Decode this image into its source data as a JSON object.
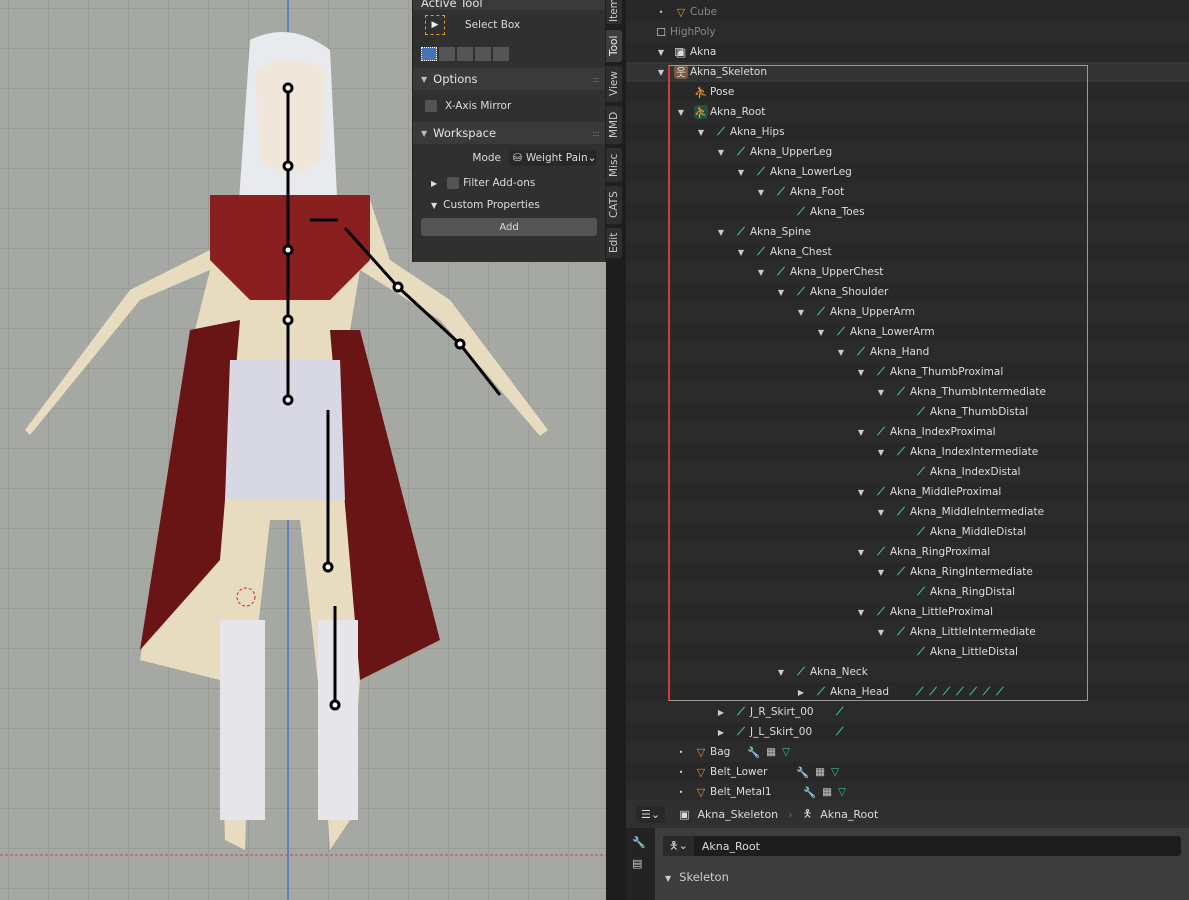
{
  "viewport": {
    "background": "#a6a8a4"
  },
  "npanel": {
    "active_tool_header": "Active Tool",
    "tool_name": "Select Box",
    "options_header": "Options",
    "x_axis_mirror": "X-Axis Mirror",
    "workspace_header": "Workspace",
    "mode_label": "Mode",
    "mode_value": "Weight Pain",
    "filter_addons": "Filter Add-ons",
    "custom_properties": "Custom Properties",
    "add_button": "Add"
  },
  "side_tabs": [
    "Item",
    "Tool",
    "View",
    "MMD",
    "Misc",
    "CATS",
    "Edit"
  ],
  "outliner": {
    "rows": [
      {
        "label": "Cube",
        "depth": 0,
        "icon": "mesh",
        "exp": "dot",
        "dim": true
      },
      {
        "label": "HighPoly",
        "depth": -1,
        "icon": "checkbox",
        "exp": "",
        "dim": true
      },
      {
        "label": "Akna",
        "depth": 0,
        "icon": "collection",
        "exp": "open",
        "check": true,
        "ind": -2
      },
      {
        "label": "Akna_Skeleton",
        "depth": 0,
        "icon": "armature",
        "exp": "open",
        "ind": -1
      },
      {
        "label": "Pose",
        "depth": 1,
        "icon": "pose",
        "exp": ""
      },
      {
        "label": "Akna_Root",
        "depth": 1,
        "icon": "armature-data",
        "exp": "open"
      },
      {
        "label": "Akna_Hips",
        "depth": 2,
        "icon": "bone",
        "exp": "open"
      },
      {
        "label": "Akna_UpperLeg",
        "depth": 3,
        "icon": "bone",
        "exp": "open"
      },
      {
        "label": "Akna_LowerLeg",
        "depth": 4,
        "icon": "bone",
        "exp": "open"
      },
      {
        "label": "Akna_Foot",
        "depth": 5,
        "icon": "bone",
        "exp": "open"
      },
      {
        "label": "Akna_Toes",
        "depth": 6,
        "icon": "bone",
        "exp": ""
      },
      {
        "label": "Akna_Spine",
        "depth": 3,
        "icon": "bone",
        "exp": "open"
      },
      {
        "label": "Akna_Chest",
        "depth": 4,
        "icon": "bone",
        "exp": "open"
      },
      {
        "label": "Akna_UpperChest",
        "depth": 5,
        "icon": "bone",
        "exp": "open"
      },
      {
        "label": "Akna_Shoulder",
        "depth": 6,
        "icon": "bone",
        "exp": "open"
      },
      {
        "label": "Akna_UpperArm",
        "depth": 7,
        "icon": "bone",
        "exp": "open"
      },
      {
        "label": "Akna_LowerArm",
        "depth": 8,
        "icon": "bone",
        "exp": "open"
      },
      {
        "label": "Akna_Hand",
        "depth": 9,
        "icon": "bone",
        "exp": "open"
      },
      {
        "label": "Akna_ThumbProximal",
        "depth": 10,
        "icon": "bone",
        "exp": "open"
      },
      {
        "label": "Akna_ThumbIntermediate",
        "depth": 11,
        "icon": "bone",
        "exp": "open"
      },
      {
        "label": "Akna_ThumbDistal",
        "depth": 12,
        "icon": "bone",
        "exp": ""
      },
      {
        "label": "Akna_IndexProximal",
        "depth": 10,
        "icon": "bone",
        "exp": "open"
      },
      {
        "label": "Akna_IndexIntermediate",
        "depth": 11,
        "icon": "bone",
        "exp": "open"
      },
      {
        "label": "Akna_IndexDistal",
        "depth": 12,
        "icon": "bone",
        "exp": ""
      },
      {
        "label": "Akna_MiddleProximal",
        "depth": 10,
        "icon": "bone",
        "exp": "open"
      },
      {
        "label": "Akna_MiddleIntermediate",
        "depth": 11,
        "icon": "bone",
        "exp": "open"
      },
      {
        "label": "Akna_MiddleDistal",
        "depth": 12,
        "icon": "bone",
        "exp": ""
      },
      {
        "label": "Akna_RingProximal",
        "depth": 10,
        "icon": "bone",
        "exp": "open"
      },
      {
        "label": "Akna_RingIntermediate",
        "depth": 11,
        "icon": "bone",
        "exp": "open"
      },
      {
        "label": "Akna_RingDistal",
        "depth": 12,
        "icon": "bone",
        "exp": ""
      },
      {
        "label": "Akna_LittleProximal",
        "depth": 10,
        "icon": "bone",
        "exp": "open"
      },
      {
        "label": "Akna_LittleIntermediate",
        "depth": 11,
        "icon": "bone",
        "exp": "open"
      },
      {
        "label": "Akna_LittleDistal",
        "depth": 12,
        "icon": "bone",
        "exp": ""
      },
      {
        "label": "Akna_Neck",
        "depth": 6,
        "icon": "bone",
        "exp": "open"
      },
      {
        "label": "Akna_Head",
        "depth": 7,
        "icon": "bone",
        "exp": "closed",
        "children_bones": 7
      },
      {
        "label": "J_R_Skirt_00",
        "depth": 3,
        "icon": "bone",
        "exp": "closed",
        "children_bones": 1
      },
      {
        "label": "J_L_Skirt_00",
        "depth": 3,
        "icon": "bone",
        "exp": "closed",
        "children_bones": 1
      },
      {
        "label": "Bag",
        "depth": 1,
        "icon": "mesh",
        "exp": "dot",
        "extras": true
      },
      {
        "label": "Belt_Lower",
        "depth": 1,
        "icon": "mesh",
        "exp": "dot",
        "extras": true
      },
      {
        "label": "Belt_Metal1",
        "depth": 1,
        "icon": "mesh",
        "exp": "dot",
        "extras": true
      }
    ]
  },
  "properties": {
    "breadcrumb_object": "Akna_Skeleton",
    "breadcrumb_data": "Akna_Root",
    "datablock_name": "Akna_Root",
    "section": "Skeleton"
  }
}
